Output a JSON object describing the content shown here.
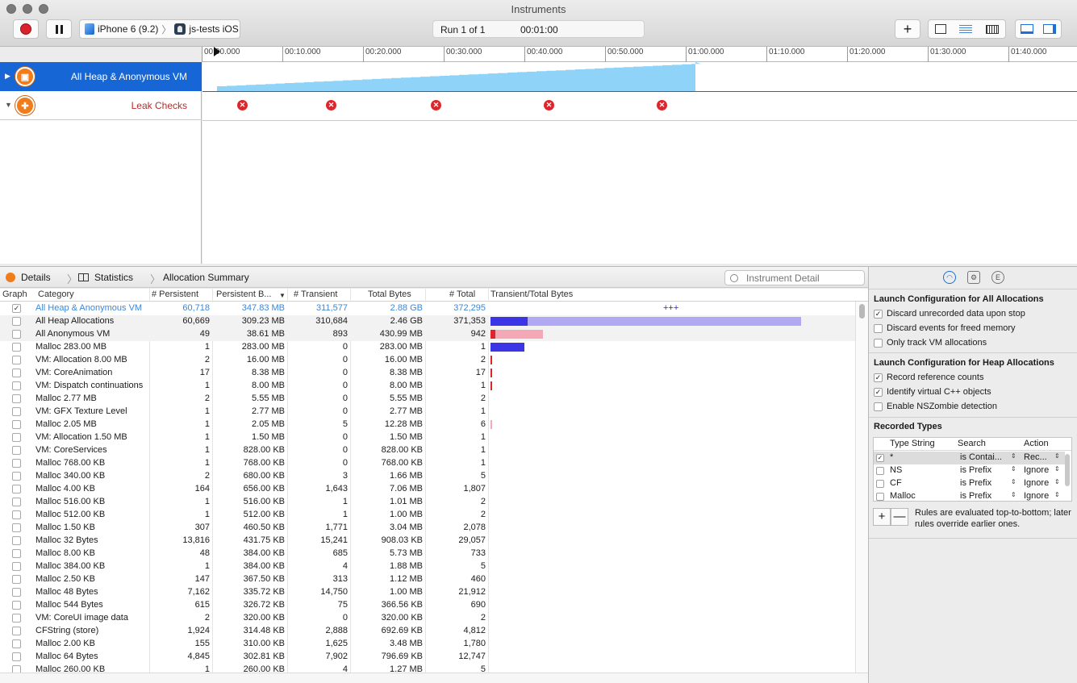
{
  "window": {
    "title": "Instruments"
  },
  "toolbar": {
    "device": "iPhone 6 (9.2)",
    "app": "js-tests iOS",
    "run_label": "Run 1 of 1",
    "run_time": "00:01:00",
    "add_symbol": "+"
  },
  "ruler": {
    "ticks": [
      "00:00.000",
      "00:10.000",
      "00:20.000",
      "00:30.000",
      "00:40.000",
      "00:50.000",
      "01:00.000",
      "01:10.000",
      "01:20.000",
      "01:30.000",
      "01:40.000"
    ]
  },
  "tracks": [
    {
      "label": "All Heap & Anonymous VM",
      "selected": true
    },
    {
      "label": "Leak Checks",
      "selected": false
    }
  ],
  "timeline": {
    "allocation_recorded_fraction": 0.6,
    "leak_check_times": [
      "00:05",
      "00:16",
      "00:29",
      "00:43",
      "00:57"
    ]
  },
  "detail_bar": {
    "details": "Details",
    "statistics": "Statistics",
    "summary": "Allocation Summary",
    "search_placeholder": "Instrument Detail"
  },
  "table": {
    "columns": [
      "Graph",
      "Category",
      "# Persistent",
      "Persistent B...",
      "# Transient",
      "Total Bytes",
      "# Total",
      "Transient/Total Bytes"
    ],
    "overflow_marker": "+++",
    "rows": [
      {
        "checked": true,
        "category": "All Heap & Anonymous VM",
        "persistent": "60,718",
        "persistent_bytes": "347.83 MB",
        "transient": "311,577",
        "total_bytes": "2.88 GB",
        "total": "372,295",
        "pers_bar": 0,
        "total_bar": 0
      },
      {
        "checked": false,
        "category": "All Heap Allocations",
        "persistent": "60,669",
        "persistent_bytes": "309.23 MB",
        "transient": "310,684",
        "total_bytes": "2.46 GB",
        "total": "371,353",
        "pers_bar": 0.12,
        "total_bar": 1.0
      },
      {
        "checked": false,
        "category": "All Anonymous VM",
        "persistent": "49",
        "persistent_bytes": "38.61 MB",
        "transient": "893",
        "total_bytes": "430.99 MB",
        "total": "942",
        "pers_bar": 0.015,
        "total_bar": 0.17
      },
      {
        "checked": false,
        "category": "Malloc 283.00 MB",
        "persistent": "1",
        "persistent_bytes": "283.00 MB",
        "transient": "0",
        "total_bytes": "283.00 MB",
        "total": "1",
        "pers_bar": 0.11,
        "total_bar": 0.11
      },
      {
        "checked": false,
        "category": "VM: Allocation 8.00 MB",
        "persistent": "2",
        "persistent_bytes": "16.00 MB",
        "transient": "0",
        "total_bytes": "16.00 MB",
        "total": "2",
        "pers_bar": 0.006,
        "total_bar": 0.006
      },
      {
        "checked": false,
        "category": "VM: CoreAnimation",
        "persistent": "17",
        "persistent_bytes": "8.38 MB",
        "transient": "0",
        "total_bytes": "8.38 MB",
        "total": "17",
        "pers_bar": 0.004,
        "total_bar": 0.004
      },
      {
        "checked": false,
        "category": "VM: Dispatch continuations",
        "persistent": "1",
        "persistent_bytes": "8.00 MB",
        "transient": "0",
        "total_bytes": "8.00 MB",
        "total": "1",
        "pers_bar": 0.003,
        "total_bar": 0.003
      },
      {
        "checked": false,
        "category": "Malloc 2.77 MB",
        "persistent": "2",
        "persistent_bytes": "5.55 MB",
        "transient": "0",
        "total_bytes": "5.55 MB",
        "total": "2",
        "pers_bar": 0,
        "total_bar": 0
      },
      {
        "checked": false,
        "category": "VM: GFX Texture Level",
        "persistent": "1",
        "persistent_bytes": "2.77 MB",
        "transient": "0",
        "total_bytes": "2.77 MB",
        "total": "1",
        "pers_bar": 0,
        "total_bar": 0
      },
      {
        "checked": false,
        "category": "Malloc 2.05 MB",
        "persistent": "1",
        "persistent_bytes": "2.05 MB",
        "transient": "5",
        "total_bytes": "12.28 MB",
        "total": "6",
        "pers_bar": 0,
        "total_bar": 0.004
      },
      {
        "checked": false,
        "category": "VM: Allocation 1.50 MB",
        "persistent": "1",
        "persistent_bytes": "1.50 MB",
        "transient": "0",
        "total_bytes": "1.50 MB",
        "total": "1",
        "pers_bar": 0,
        "total_bar": 0
      },
      {
        "checked": false,
        "category": "VM: CoreServices",
        "persistent": "1",
        "persistent_bytes": "828.00 KB",
        "transient": "0",
        "total_bytes": "828.00 KB",
        "total": "1",
        "pers_bar": 0,
        "total_bar": 0
      },
      {
        "checked": false,
        "category": "Malloc 768.00 KB",
        "persistent": "1",
        "persistent_bytes": "768.00 KB",
        "transient": "0",
        "total_bytes": "768.00 KB",
        "total": "1",
        "pers_bar": 0,
        "total_bar": 0
      },
      {
        "checked": false,
        "category": "Malloc 340.00 KB",
        "persistent": "2",
        "persistent_bytes": "680.00 KB",
        "transient": "3",
        "total_bytes": "1.66 MB",
        "total": "5",
        "pers_bar": 0,
        "total_bar": 0
      },
      {
        "checked": false,
        "category": "Malloc 4.00 KB",
        "persistent": "164",
        "persistent_bytes": "656.00 KB",
        "transient": "1,643",
        "total_bytes": "7.06 MB",
        "total": "1,807",
        "pers_bar": 0,
        "total_bar": 0
      },
      {
        "checked": false,
        "category": "Malloc 516.00 KB",
        "persistent": "1",
        "persistent_bytes": "516.00 KB",
        "transient": "1",
        "total_bytes": "1.01 MB",
        "total": "2",
        "pers_bar": 0,
        "total_bar": 0
      },
      {
        "checked": false,
        "category": "Malloc 512.00 KB",
        "persistent": "1",
        "persistent_bytes": "512.00 KB",
        "transient": "1",
        "total_bytes": "1.00 MB",
        "total": "2",
        "pers_bar": 0,
        "total_bar": 0
      },
      {
        "checked": false,
        "category": "Malloc 1.50 KB",
        "persistent": "307",
        "persistent_bytes": "460.50 KB",
        "transient": "1,771",
        "total_bytes": "3.04 MB",
        "total": "2,078",
        "pers_bar": 0,
        "total_bar": 0
      },
      {
        "checked": false,
        "category": "Malloc 32 Bytes",
        "persistent": "13,816",
        "persistent_bytes": "431.75 KB",
        "transient": "15,241",
        "total_bytes": "908.03 KB",
        "total": "29,057",
        "pers_bar": 0,
        "total_bar": 0
      },
      {
        "checked": false,
        "category": "Malloc 8.00 KB",
        "persistent": "48",
        "persistent_bytes": "384.00 KB",
        "transient": "685",
        "total_bytes": "5.73 MB",
        "total": "733",
        "pers_bar": 0,
        "total_bar": 0
      },
      {
        "checked": false,
        "category": "Malloc 384.00 KB",
        "persistent": "1",
        "persistent_bytes": "384.00 KB",
        "transient": "4",
        "total_bytes": "1.88 MB",
        "total": "5",
        "pers_bar": 0,
        "total_bar": 0
      },
      {
        "checked": false,
        "category": "Malloc 2.50 KB",
        "persistent": "147",
        "persistent_bytes": "367.50 KB",
        "transient": "313",
        "total_bytes": "1.12 MB",
        "total": "460",
        "pers_bar": 0,
        "total_bar": 0
      },
      {
        "checked": false,
        "category": "Malloc 48 Bytes",
        "persistent": "7,162",
        "persistent_bytes": "335.72 KB",
        "transient": "14,750",
        "total_bytes": "1.00 MB",
        "total": "21,912",
        "pers_bar": 0,
        "total_bar": 0
      },
      {
        "checked": false,
        "category": "Malloc 544 Bytes",
        "persistent": "615",
        "persistent_bytes": "326.72 KB",
        "transient": "75",
        "total_bytes": "366.56 KB",
        "total": "690",
        "pers_bar": 0,
        "total_bar": 0
      },
      {
        "checked": false,
        "category": "VM: CoreUI image data",
        "persistent": "2",
        "persistent_bytes": "320.00 KB",
        "transient": "0",
        "total_bytes": "320.00 KB",
        "total": "2",
        "pers_bar": 0,
        "total_bar": 0
      },
      {
        "checked": false,
        "category": "CFString (store)",
        "persistent": "1,924",
        "persistent_bytes": "314.48 KB",
        "transient": "2,888",
        "total_bytes": "692.69 KB",
        "total": "4,812",
        "pers_bar": 0,
        "total_bar": 0
      },
      {
        "checked": false,
        "category": "Malloc 2.00 KB",
        "persistent": "155",
        "persistent_bytes": "310.00 KB",
        "transient": "1,625",
        "total_bytes": "3.48 MB",
        "total": "1,780",
        "pers_bar": 0,
        "total_bar": 0
      },
      {
        "checked": false,
        "category": "Malloc 64 Bytes",
        "persistent": "4,845",
        "persistent_bytes": "302.81 KB",
        "transient": "7,902",
        "total_bytes": "796.69 KB",
        "total": "12,747",
        "pers_bar": 0,
        "total_bar": 0
      },
      {
        "checked": false,
        "category": "Malloc 260.00 KB",
        "persistent": "1",
        "persistent_bytes": "260.00 KB",
        "transient": "4",
        "total_bytes": "1.27 MB",
        "total": "5",
        "pers_bar": 0,
        "total_bar": 0
      }
    ]
  },
  "inspector": {
    "section1_title": "Launch Configuration for All Allocations",
    "section1_options": [
      {
        "label": "Discard unrecorded data upon stop",
        "checked": true
      },
      {
        "label": "Discard events for freed memory",
        "checked": false
      },
      {
        "label": "Only track VM allocations",
        "checked": false
      }
    ],
    "section2_title": "Launch Configuration for Heap Allocations",
    "section2_options": [
      {
        "label": "Record reference counts",
        "checked": true
      },
      {
        "label": "Identify virtual C++ objects",
        "checked": true
      },
      {
        "label": "Enable NSZombie detection",
        "checked": false
      }
    ],
    "recorded_types_title": "Recorded Types",
    "recorded_types_columns": [
      "Type String",
      "Search",
      "Action"
    ],
    "recorded_types": [
      {
        "checked": true,
        "type": "*",
        "search": "is Contai...",
        "action": "Rec..."
      },
      {
        "checked": false,
        "type": "NS",
        "search": "is Prefix",
        "action": "Ignore"
      },
      {
        "checked": false,
        "type": "CF",
        "search": "is Prefix",
        "action": "Ignore"
      },
      {
        "checked": false,
        "type": "Malloc",
        "search": "is Prefix",
        "action": "Ignore"
      }
    ],
    "add_label": "+",
    "remove_label": "—",
    "rules_note": "Rules are evaluated top-to-bottom; later rules override earlier ones."
  },
  "colors": {
    "selection_blue": "#1766d6",
    "persistent_bar": "#3b35e6",
    "transient_bar": "#b0a8f2",
    "leak_red": "#e0242b",
    "anon_persistent": "#e0242b",
    "anon_transient": "#f4a8b6",
    "graph_fill": "#8fd3f8"
  }
}
